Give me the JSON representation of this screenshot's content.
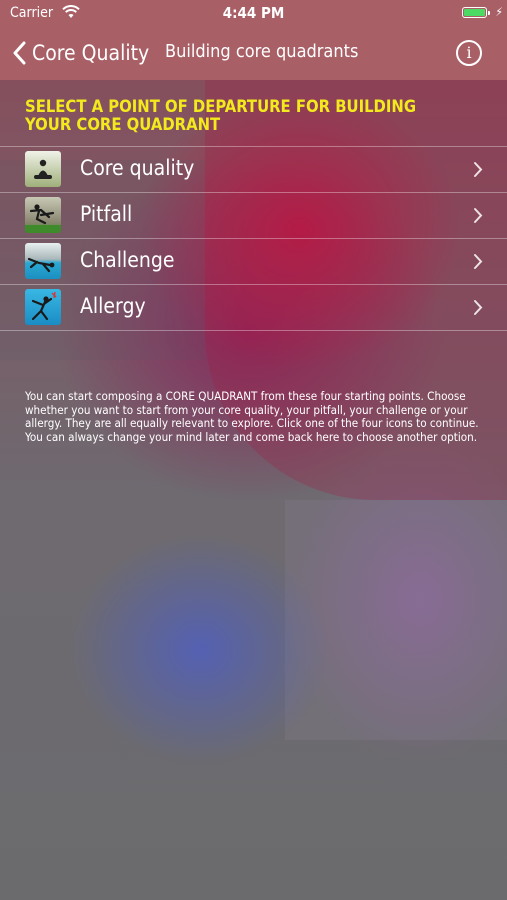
{
  "status_bar": {
    "carrier": "Carrier",
    "time": "4:44 PM",
    "battery_level": 1.0,
    "battery_color": "#4cd964"
  },
  "nav": {
    "back_label": "Core Quality",
    "title": "Building core quadrants",
    "info_icon": "info-icon"
  },
  "instruction": "SELECT A POINT OF DEPARTURE FOR BUILDING YOUR CORE QUADRANT",
  "menu": {
    "items": [
      {
        "label": "Core quality",
        "icon": "meditation-icon"
      },
      {
        "label": "Pitfall",
        "icon": "falling-figure-icon"
      },
      {
        "label": "Challenge",
        "icon": "flying-figure-icon"
      },
      {
        "label": "Allergy",
        "icon": "struggling-figure-icon"
      }
    ]
  },
  "description": "You can start composing a CORE QUADRANT from these four starting points. Choose whether you want to start from your core quality, your pitfall, your challenge or your allergy. They are all equally relevant to explore. Click one of the four icons to continue. You can always change your mind later and come back here to choose another option.",
  "colors": {
    "header_bg": "#a86066",
    "instruction_text": "#f2ea1c"
  }
}
